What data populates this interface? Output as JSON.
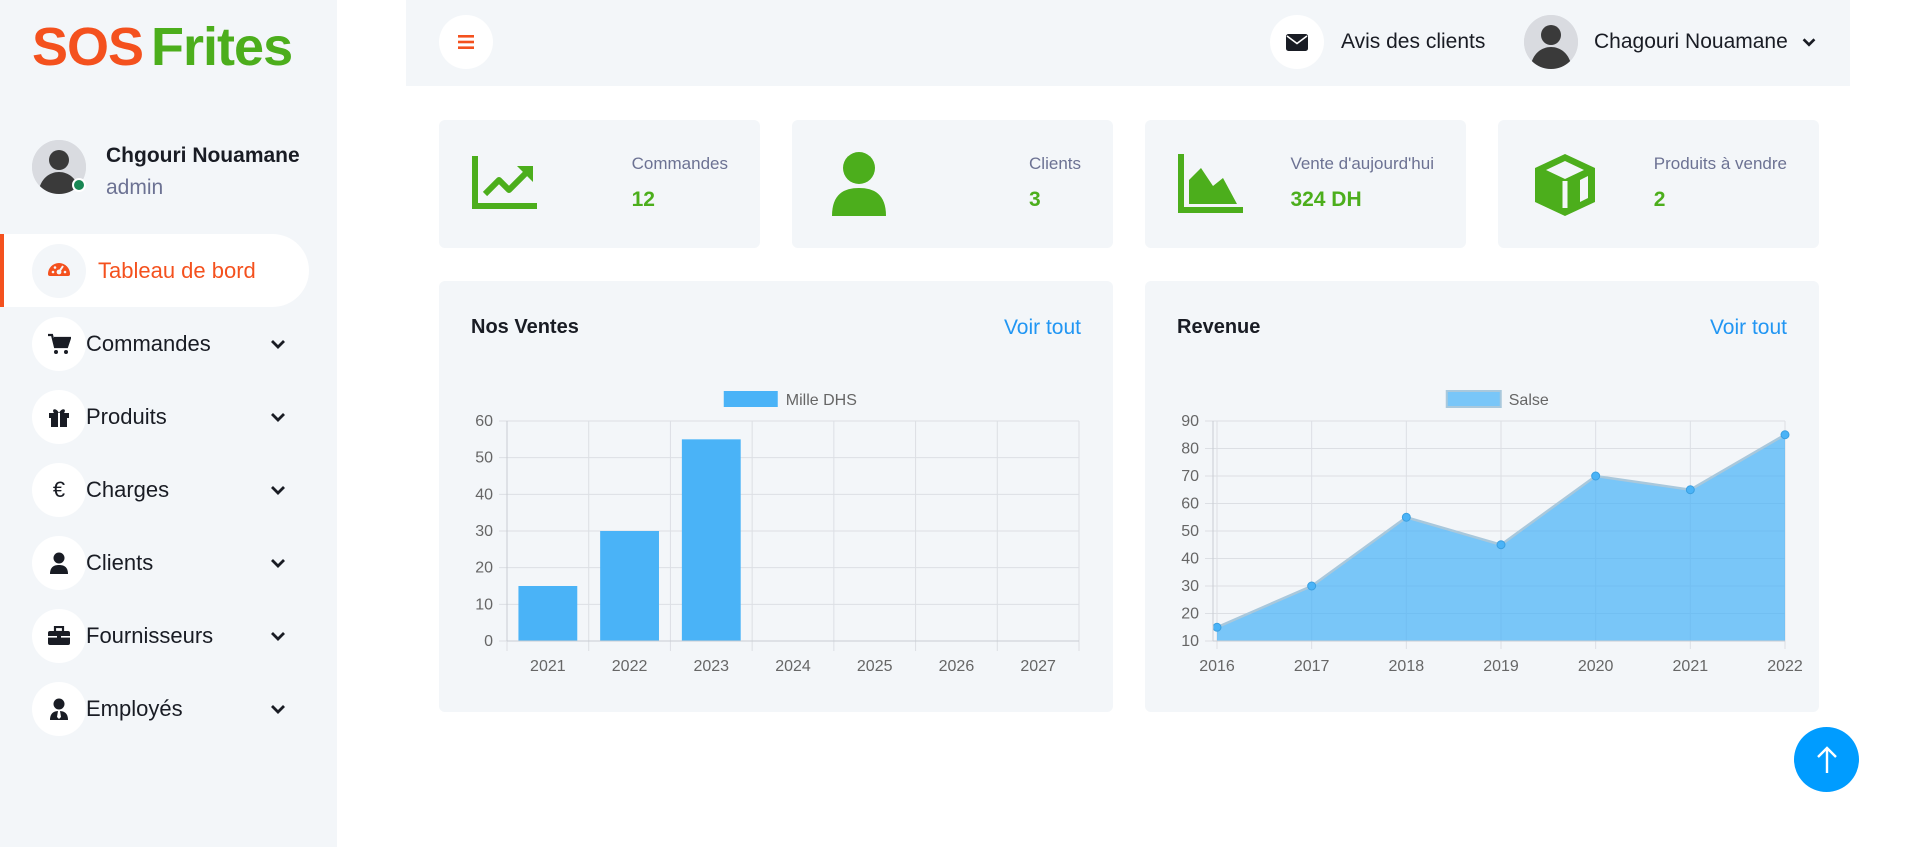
{
  "brand": {
    "part1": "SOS",
    "part2": "Frites"
  },
  "profile": {
    "name": "Chgouri Nouamane",
    "role": "admin"
  },
  "nav": [
    {
      "label": "Tableau de bord",
      "icon": "dashboard-icon",
      "active": true
    },
    {
      "label": "Commandes",
      "icon": "cart-icon"
    },
    {
      "label": "Produits",
      "icon": "gift-icon"
    },
    {
      "label": "Charges",
      "icon": "euro-icon",
      "glyph": "€"
    },
    {
      "label": "Clients",
      "icon": "user-icon"
    },
    {
      "label": "Fournisseurs",
      "icon": "briefcase-icon"
    },
    {
      "label": "Employés",
      "icon": "user-tie-icon"
    }
  ],
  "topbar": {
    "messages_label": "Avis des clients",
    "user_name": "Chagouri Nouamane"
  },
  "stats": [
    {
      "label": "Commandes",
      "value": "12",
      "icon": "chart-line-icon"
    },
    {
      "label": "Clients",
      "value": "3",
      "icon": "user-icon"
    },
    {
      "label": "Vente d'aujourd'hui",
      "value": "324 DH",
      "icon": "chart-area-icon"
    },
    {
      "label": "Produits à vendre",
      "value": "2",
      "icon": "box-icon"
    }
  ],
  "sales_card": {
    "title": "Nos Ventes",
    "link": "Voir tout"
  },
  "revenue_card": {
    "title": "Revenue",
    "link": "Voir tout"
  },
  "colors": {
    "accent": "#f4511e",
    "green": "#4cae1c",
    "link": "#2196f3",
    "bar": "#4ab3f7"
  },
  "chart_data": [
    {
      "type": "bar",
      "title": "Nos Ventes",
      "categories": [
        "2021",
        "2022",
        "2023",
        "2024",
        "2025",
        "2026",
        "2027"
      ],
      "series": [
        {
          "name": "Mille DHS",
          "values": [
            15,
            30,
            55,
            null,
            null,
            null,
            null
          ]
        }
      ],
      "ylim": [
        0,
        60
      ],
      "yticks": [
        0,
        10,
        20,
        30,
        40,
        50,
        60
      ],
      "grid": true,
      "legend": "top-center"
    },
    {
      "type": "area",
      "title": "Revenue",
      "categories": [
        "2016",
        "2017",
        "2018",
        "2019",
        "2020",
        "2021",
        "2022"
      ],
      "series": [
        {
          "name": "Salse",
          "values": [
            15,
            30,
            55,
            45,
            70,
            65,
            85
          ]
        }
      ],
      "ylim": [
        10,
        90
      ],
      "yticks": [
        10,
        20,
        30,
        40,
        50,
        60,
        70,
        80,
        90
      ],
      "grid": true,
      "legend": "top-center"
    }
  ]
}
